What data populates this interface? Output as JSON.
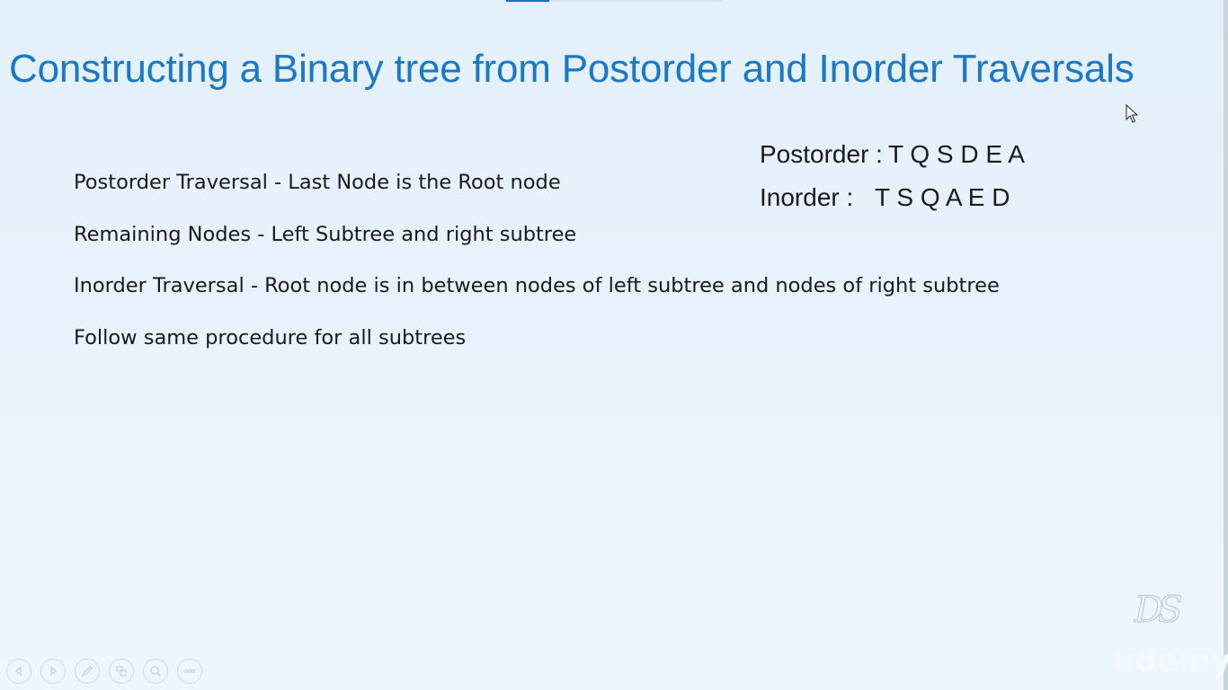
{
  "slide": {
    "title": "Constructing a Binary tree from Postorder and Inorder Traversals",
    "bullets": [
      "Postorder Traversal  -  Last Node is the Root node",
      "Remaining Nodes - Left Subtree and right subtree",
      "Inorder Traversal  -  Root node is in between nodes of left subtree and nodes of right subtree",
      "Follow same procedure for all subtrees"
    ],
    "traversals": {
      "postorder": {
        "label": "Postorder :",
        "sequence": "T Q S D E A"
      },
      "inorder": {
        "label": "Inorder :",
        "sequence": "T S Q A E D"
      }
    }
  },
  "watermark": {
    "logo": "DS",
    "brand": "udemy"
  },
  "controls": [
    "previous-icon",
    "next-icon",
    "pen-icon",
    "slides-icon",
    "zoom-icon",
    "more-icon"
  ],
  "colors": {
    "title": "#1a78c6",
    "text": "#1a1a1a",
    "background": "#e6f1fb"
  }
}
